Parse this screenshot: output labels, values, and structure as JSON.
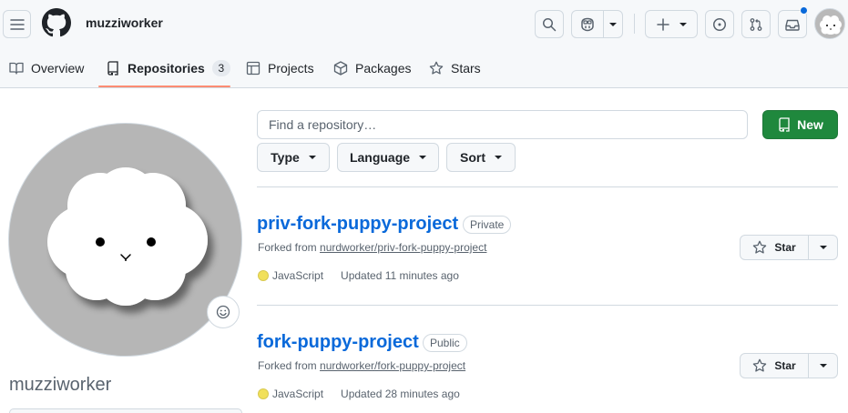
{
  "header": {
    "username": "muzziworker",
    "notification_dot_color": "#0969da"
  },
  "tabs": [
    {
      "label": "Overview",
      "icon": "book-icon"
    },
    {
      "label": "Repositories",
      "icon": "repo-icon",
      "count": "3",
      "active": true
    },
    {
      "label": "Projects",
      "icon": "table-icon"
    },
    {
      "label": "Packages",
      "icon": "package-icon"
    },
    {
      "label": "Stars",
      "icon": "star-icon"
    }
  ],
  "profile": {
    "name": "muzziworker"
  },
  "controls": {
    "search_placeholder": "Find a repository…",
    "new_label": "New",
    "type_label": "Type",
    "language_label": "Language",
    "sort_label": "Sort"
  },
  "repos": [
    {
      "name": "priv-fork-puppy-project",
      "visibility": "Private",
      "forked_prefix": "Forked from",
      "forked_from": "nurdworker/priv-fork-puppy-project",
      "language": "JavaScript",
      "language_color": "#f1e05a",
      "updated": "Updated 11 minutes ago",
      "star_label": "Star"
    },
    {
      "name": "fork-puppy-project",
      "visibility": "Public",
      "forked_prefix": "Forked from",
      "forked_from": "nurdworker/fork-puppy-project",
      "language": "JavaScript",
      "language_color": "#f1e05a",
      "updated": "Updated 28 minutes ago",
      "star_label": "Star"
    }
  ],
  "colors": {
    "accent_link": "#0969da",
    "new_button": "#1f883d",
    "tab_underline": "#fd8c73"
  }
}
